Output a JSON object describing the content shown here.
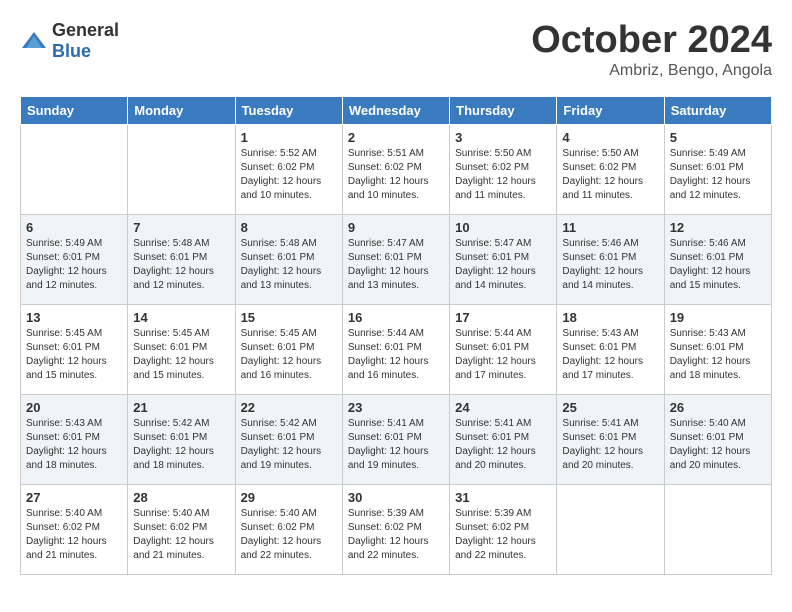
{
  "header": {
    "logo_general": "General",
    "logo_blue": "Blue",
    "month_title": "October 2024",
    "subtitle": "Ambriz, Bengo, Angola"
  },
  "days_of_week": [
    "Sunday",
    "Monday",
    "Tuesday",
    "Wednesday",
    "Thursday",
    "Friday",
    "Saturday"
  ],
  "weeks": [
    [
      {
        "day": "",
        "sunrise": "",
        "sunset": "",
        "daylight": ""
      },
      {
        "day": "",
        "sunrise": "",
        "sunset": "",
        "daylight": ""
      },
      {
        "day": "1",
        "sunrise": "Sunrise: 5:52 AM",
        "sunset": "Sunset: 6:02 PM",
        "daylight": "Daylight: 12 hours and 10 minutes."
      },
      {
        "day": "2",
        "sunrise": "Sunrise: 5:51 AM",
        "sunset": "Sunset: 6:02 PM",
        "daylight": "Daylight: 12 hours and 10 minutes."
      },
      {
        "day": "3",
        "sunrise": "Sunrise: 5:50 AM",
        "sunset": "Sunset: 6:02 PM",
        "daylight": "Daylight: 12 hours and 11 minutes."
      },
      {
        "day": "4",
        "sunrise": "Sunrise: 5:50 AM",
        "sunset": "Sunset: 6:02 PM",
        "daylight": "Daylight: 12 hours and 11 minutes."
      },
      {
        "day": "5",
        "sunrise": "Sunrise: 5:49 AM",
        "sunset": "Sunset: 6:01 PM",
        "daylight": "Daylight: 12 hours and 12 minutes."
      }
    ],
    [
      {
        "day": "6",
        "sunrise": "Sunrise: 5:49 AM",
        "sunset": "Sunset: 6:01 PM",
        "daylight": "Daylight: 12 hours and 12 minutes."
      },
      {
        "day": "7",
        "sunrise": "Sunrise: 5:48 AM",
        "sunset": "Sunset: 6:01 PM",
        "daylight": "Daylight: 12 hours and 12 minutes."
      },
      {
        "day": "8",
        "sunrise": "Sunrise: 5:48 AM",
        "sunset": "Sunset: 6:01 PM",
        "daylight": "Daylight: 12 hours and 13 minutes."
      },
      {
        "day": "9",
        "sunrise": "Sunrise: 5:47 AM",
        "sunset": "Sunset: 6:01 PM",
        "daylight": "Daylight: 12 hours and 13 minutes."
      },
      {
        "day": "10",
        "sunrise": "Sunrise: 5:47 AM",
        "sunset": "Sunset: 6:01 PM",
        "daylight": "Daylight: 12 hours and 14 minutes."
      },
      {
        "day": "11",
        "sunrise": "Sunrise: 5:46 AM",
        "sunset": "Sunset: 6:01 PM",
        "daylight": "Daylight: 12 hours and 14 minutes."
      },
      {
        "day": "12",
        "sunrise": "Sunrise: 5:46 AM",
        "sunset": "Sunset: 6:01 PM",
        "daylight": "Daylight: 12 hours and 15 minutes."
      }
    ],
    [
      {
        "day": "13",
        "sunrise": "Sunrise: 5:45 AM",
        "sunset": "Sunset: 6:01 PM",
        "daylight": "Daylight: 12 hours and 15 minutes."
      },
      {
        "day": "14",
        "sunrise": "Sunrise: 5:45 AM",
        "sunset": "Sunset: 6:01 PM",
        "daylight": "Daylight: 12 hours and 15 minutes."
      },
      {
        "day": "15",
        "sunrise": "Sunrise: 5:45 AM",
        "sunset": "Sunset: 6:01 PM",
        "daylight": "Daylight: 12 hours and 16 minutes."
      },
      {
        "day": "16",
        "sunrise": "Sunrise: 5:44 AM",
        "sunset": "Sunset: 6:01 PM",
        "daylight": "Daylight: 12 hours and 16 minutes."
      },
      {
        "day": "17",
        "sunrise": "Sunrise: 5:44 AM",
        "sunset": "Sunset: 6:01 PM",
        "daylight": "Daylight: 12 hours and 17 minutes."
      },
      {
        "day": "18",
        "sunrise": "Sunrise: 5:43 AM",
        "sunset": "Sunset: 6:01 PM",
        "daylight": "Daylight: 12 hours and 17 minutes."
      },
      {
        "day": "19",
        "sunrise": "Sunrise: 5:43 AM",
        "sunset": "Sunset: 6:01 PM",
        "daylight": "Daylight: 12 hours and 18 minutes."
      }
    ],
    [
      {
        "day": "20",
        "sunrise": "Sunrise: 5:43 AM",
        "sunset": "Sunset: 6:01 PM",
        "daylight": "Daylight: 12 hours and 18 minutes."
      },
      {
        "day": "21",
        "sunrise": "Sunrise: 5:42 AM",
        "sunset": "Sunset: 6:01 PM",
        "daylight": "Daylight: 12 hours and 18 minutes."
      },
      {
        "day": "22",
        "sunrise": "Sunrise: 5:42 AM",
        "sunset": "Sunset: 6:01 PM",
        "daylight": "Daylight: 12 hours and 19 minutes."
      },
      {
        "day": "23",
        "sunrise": "Sunrise: 5:41 AM",
        "sunset": "Sunset: 6:01 PM",
        "daylight": "Daylight: 12 hours and 19 minutes."
      },
      {
        "day": "24",
        "sunrise": "Sunrise: 5:41 AM",
        "sunset": "Sunset: 6:01 PM",
        "daylight": "Daylight: 12 hours and 20 minutes."
      },
      {
        "day": "25",
        "sunrise": "Sunrise: 5:41 AM",
        "sunset": "Sunset: 6:01 PM",
        "daylight": "Daylight: 12 hours and 20 minutes."
      },
      {
        "day": "26",
        "sunrise": "Sunrise: 5:40 AM",
        "sunset": "Sunset: 6:01 PM",
        "daylight": "Daylight: 12 hours and 20 minutes."
      }
    ],
    [
      {
        "day": "27",
        "sunrise": "Sunrise: 5:40 AM",
        "sunset": "Sunset: 6:02 PM",
        "daylight": "Daylight: 12 hours and 21 minutes."
      },
      {
        "day": "28",
        "sunrise": "Sunrise: 5:40 AM",
        "sunset": "Sunset: 6:02 PM",
        "daylight": "Daylight: 12 hours and 21 minutes."
      },
      {
        "day": "29",
        "sunrise": "Sunrise: 5:40 AM",
        "sunset": "Sunset: 6:02 PM",
        "daylight": "Daylight: 12 hours and 22 minutes."
      },
      {
        "day": "30",
        "sunrise": "Sunrise: 5:39 AM",
        "sunset": "Sunset: 6:02 PM",
        "daylight": "Daylight: 12 hours and 22 minutes."
      },
      {
        "day": "31",
        "sunrise": "Sunrise: 5:39 AM",
        "sunset": "Sunset: 6:02 PM",
        "daylight": "Daylight: 12 hours and 22 minutes."
      },
      {
        "day": "",
        "sunrise": "",
        "sunset": "",
        "daylight": ""
      },
      {
        "day": "",
        "sunrise": "",
        "sunset": "",
        "daylight": ""
      }
    ]
  ]
}
